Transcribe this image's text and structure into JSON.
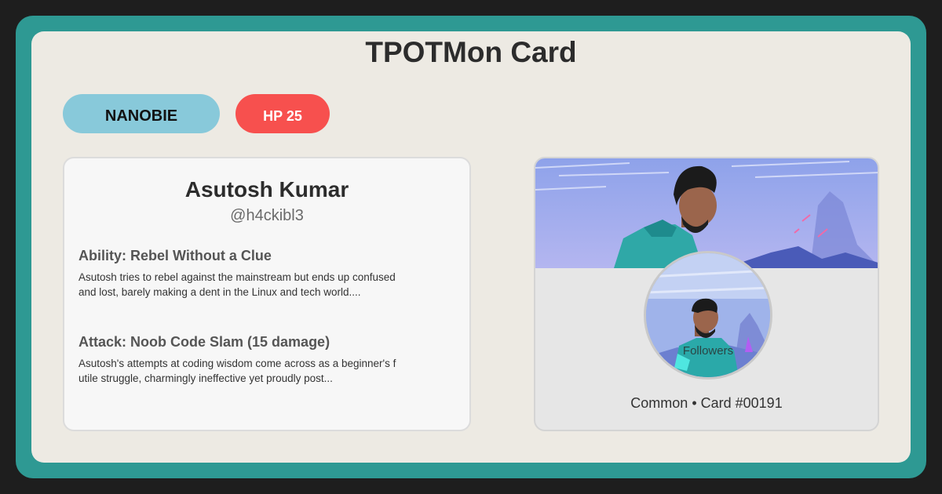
{
  "title": "TPOTMon Card",
  "badges": {
    "type": "NANOBIE",
    "hp": "HP 25"
  },
  "profile": {
    "name": "Asutosh Kumar",
    "handle": "@h4ckibl3"
  },
  "ability": {
    "title": "Ability: Rebel Without a Clue",
    "description": "Asutosh tries to rebel against the mainstream but ends up confused and lost, barely making a dent in the Linux and tech world...."
  },
  "attack": {
    "title": "Attack: Noob Code Slam (15 damage)",
    "description": "Asutosh's attempts at coding wisdom come across as a beginner's futile struggle, charmingly ineffective yet proudly post..."
  },
  "avatar_overlay": "Followers",
  "footer": "Common • Card #00191",
  "colors": {
    "frame": "#2e9993",
    "card": "#edeae3",
    "type_badge": "#88c9da",
    "hp_badge": "#f7504e"
  },
  "icons": {
    "banner": "banner-illustration-icon",
    "avatar": "avatar-illustration-icon"
  }
}
